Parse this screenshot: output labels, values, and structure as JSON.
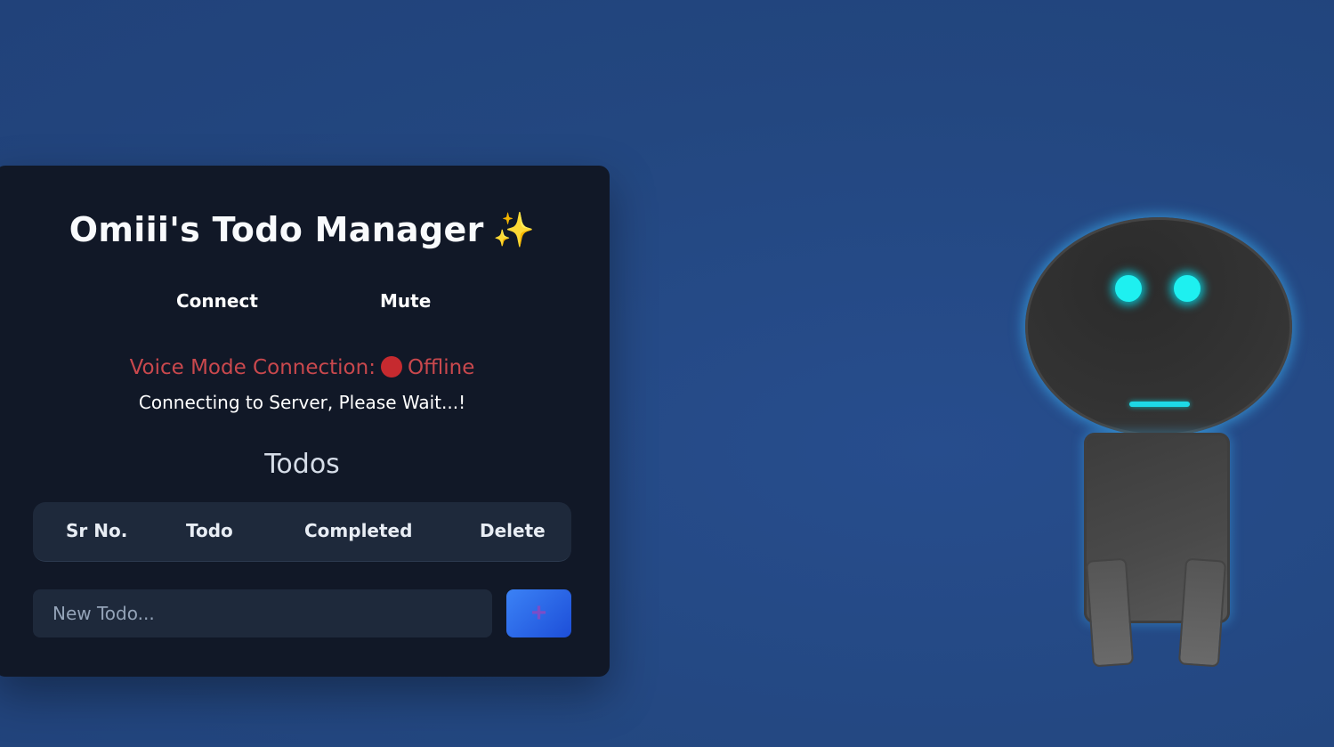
{
  "app": {
    "title": "Omiii's Todo Manager",
    "title_emoji": "✨"
  },
  "controls": {
    "connect_label": "Connect",
    "mute_label": "Mute"
  },
  "status": {
    "voice_label": "Voice Mode Connection:",
    "state": "Offline",
    "state_color": "#c62a2f",
    "message": "Connecting to Server, Please Wait...!"
  },
  "todos": {
    "heading": "Todos",
    "columns": [
      "Sr No.",
      "Todo",
      "Completed",
      "Delete"
    ],
    "rows": []
  },
  "new_todo": {
    "placeholder": "New Todo...",
    "value": "",
    "add_button_label": "+"
  },
  "colors": {
    "background": "#234780",
    "card": "#111827",
    "accent": "#3b82f6",
    "offline": "#c9484d",
    "robot_glow": "#1ef0f0"
  },
  "icons": {
    "add": "plus-icon",
    "status": "status-dot-icon",
    "title": "sparkles-icon"
  }
}
